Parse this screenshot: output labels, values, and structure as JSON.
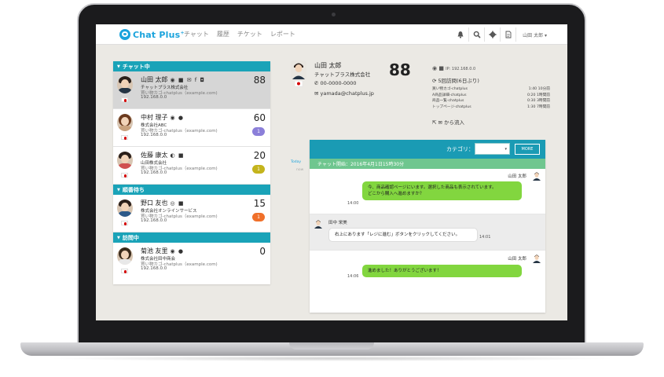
{
  "nav": {
    "logo": "Chat Plus",
    "logo_sup": "+",
    "links": [
      "チャット",
      "履歴",
      "チケット",
      "レポート"
    ],
    "user": "山田 太郎 ▾"
  },
  "sections": {
    "chatting": "チャット中",
    "waiting": "順番待ち",
    "visiting": "訪問中"
  },
  "visitors": [
    {
      "name": "山田 太郎",
      "icons": "◉ ■ ✉ f ◘",
      "company": "チャットプラス株式会社",
      "page": "買い物カゴ-chatplus（example.com)",
      "ip": "192.168.0.0",
      "score": "88",
      "badge": ""
    },
    {
      "name": "中村 理子",
      "icons": "◉ ●",
      "company": "株式会社ABC",
      "page": "買い物カゴ-chatplus（example.com)",
      "ip": "192.168.0.0",
      "score": "60",
      "badge": "1",
      "badge_color": "#8b7fd9"
    },
    {
      "name": "佐藤 康太",
      "icons": "◐ ■",
      "company": "山田株式会社",
      "page": "買い物カゴ-chatplus（example.com)",
      "ip": "192.168.0.0",
      "score": "20",
      "badge": "1",
      "badge_color": "#c4b41c"
    },
    {
      "name": "野口 友也",
      "icons": "◎ ■",
      "company": "株式会社オンラインサービス",
      "page": "買い物カゴ-chatplus（example.com)",
      "ip": "192.168.0.0",
      "score": "15",
      "badge": "1",
      "badge_color": "#f0702a"
    },
    {
      "name": "菊池 友里",
      "icons": "◉ ●",
      "company": "株式会社田中商会",
      "page": "買い物カゴ-chatplus（example.com)",
      "ip": "192.168.0.0",
      "score": "0",
      "badge": ""
    }
  ],
  "detail": {
    "name": "山田 太郎",
    "company": "チャットプラス株式会社",
    "phone": "00-0000-0000",
    "email": "yamada@chatplus.jp",
    "score": "88",
    "ip": "IP: 192.168.0.0",
    "visits": "5回訪問(6日ぶり)",
    "pages": [
      {
        "page": "買い物カゴ-chatplus",
        "time": "1:40 10分前"
      },
      {
        "page": "A商品詳細-chatplus",
        "time": "0:20 1時間前"
      },
      {
        "page": "商品一覧-chatplus",
        "time": "0:30 3時間前"
      },
      {
        "page": "トップページ-chatplus",
        "time": "1:30 7時間前"
      }
    ],
    "read": "から流入"
  },
  "timeline": {
    "today": "Today",
    "now": "now"
  },
  "chat": {
    "category_label": "カテゴリ：",
    "category_value": "▾",
    "more": "MORE",
    "start": "チャット開始：2016年4月1日15時30分",
    "messages": [
      {
        "sender": "山田 太郎",
        "line1": "今、商品確認ページにいます。選択した商品も表示されています。",
        "line2": "どこから購入へ進めますか？",
        "time": "14:00"
      },
      {
        "sender": "田中 栄美",
        "line1": "右上にあります「レジに進む」ボタンをクリックしてください。",
        "time": "14:01"
      },
      {
        "sender": "山田 太郎",
        "line1": "進めました！ありがとうございます！",
        "time": "14:06"
      }
    ]
  }
}
